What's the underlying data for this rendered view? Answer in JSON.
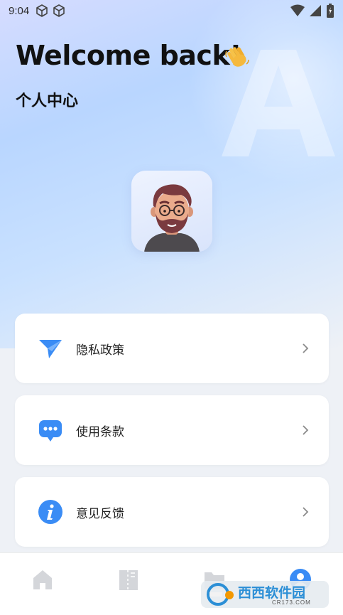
{
  "status_bar": {
    "time": "9:04",
    "icons": [
      "cube-icon",
      "cube-icon",
      "wifi-icon",
      "signal-icon",
      "battery-icon"
    ]
  },
  "header": {
    "welcome": "Welcome back!",
    "wave_icon": "waving-hand-icon",
    "subtitle": "个人中心"
  },
  "avatar": {
    "icon": "user-avatar"
  },
  "menu": [
    {
      "label": "隐私政策",
      "icon": "paper-plane-icon"
    },
    {
      "label": "使用条款",
      "icon": "chat-bubble-icon"
    },
    {
      "label": "意见反馈",
      "icon": "info-icon"
    }
  ],
  "tabbar": {
    "tabs": [
      {
        "icon": "home-icon",
        "active": false
      },
      {
        "icon": "book-icon",
        "active": false
      },
      {
        "icon": "folder-icon",
        "active": false
      },
      {
        "icon": "profile-icon",
        "active": true
      }
    ]
  },
  "watermark": {
    "text": "西西软件园",
    "sub": "CR173.COM"
  },
  "colors": {
    "accent": "#3a8cf5",
    "tab_inactive": "#d4d6da",
    "hero_top": "#d6dcff",
    "hero_mid": "#b9d6ff"
  }
}
